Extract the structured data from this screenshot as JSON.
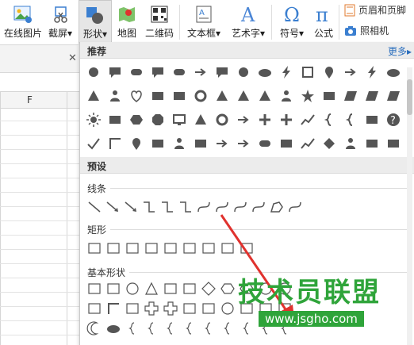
{
  "ribbon": {
    "online_image": "在线图片",
    "screenshot": "截屏",
    "shapes": "形状",
    "map": "地图",
    "qrcode": "二维码",
    "textbox": "文本框",
    "wordart": "艺术字",
    "symbol": "符号",
    "formula": "公式",
    "header_footer": "页眉和页脚",
    "camera": "照相机"
  },
  "sheet": {
    "column_f": "F"
  },
  "panel": {
    "recommended": "推荐",
    "more": "更多",
    "presets": "预设",
    "lines": "线条",
    "rectangles": "矩形",
    "basic_shapes": "基本形状"
  },
  "watermark": {
    "line1": "技术员联盟",
    "line2": "www.jsgho.com"
  },
  "colors": {
    "accent_red": "#e0322e",
    "watermark_green": "#2fa43a",
    "icon_dark": "#555555",
    "link_blue": "#2a6ebd"
  }
}
